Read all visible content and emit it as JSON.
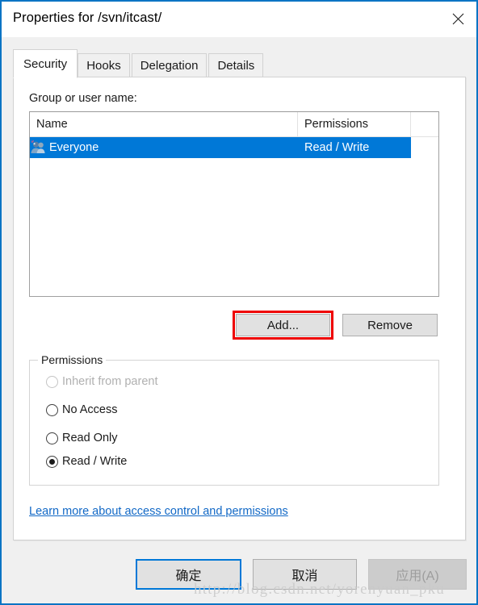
{
  "window": {
    "title": "Properties for /svn/itcast/",
    "close_icon": "close-icon",
    "border_color": "#0a74c4"
  },
  "tabs": [
    {
      "label": "Security",
      "active": true
    },
    {
      "label": "Hooks",
      "active": false
    },
    {
      "label": "Delegation",
      "active": false
    },
    {
      "label": "Details",
      "active": false
    }
  ],
  "security": {
    "group_label": "Group or user name:",
    "list": {
      "columns": [
        "Name",
        "Permissions"
      ],
      "rows": [
        {
          "name": "Everyone",
          "permissions": "Read / Write",
          "icon": "users-group-icon",
          "selected": true
        }
      ],
      "selection_color": "#0078d7"
    },
    "buttons": {
      "add": "Add...",
      "remove": "Remove",
      "add_highlight_color": "#ee0000"
    },
    "permissions_group": {
      "legend": "Permissions",
      "options": [
        {
          "label": "Inherit from parent",
          "selected": false,
          "disabled": true
        },
        {
          "label": "No Access",
          "selected": false,
          "disabled": false
        },
        {
          "label": "Read Only",
          "selected": false,
          "disabled": false
        },
        {
          "label": "Read / Write",
          "selected": true,
          "disabled": false
        }
      ]
    },
    "link": {
      "label": "Learn more about access control and permissions",
      "color": "#1168c6"
    }
  },
  "footer": {
    "ok": "确定",
    "cancel": "取消",
    "apply": "应用(A)",
    "apply_disabled": true
  },
  "watermark": "http://blog.csdn.net/yorenyuan_pku"
}
